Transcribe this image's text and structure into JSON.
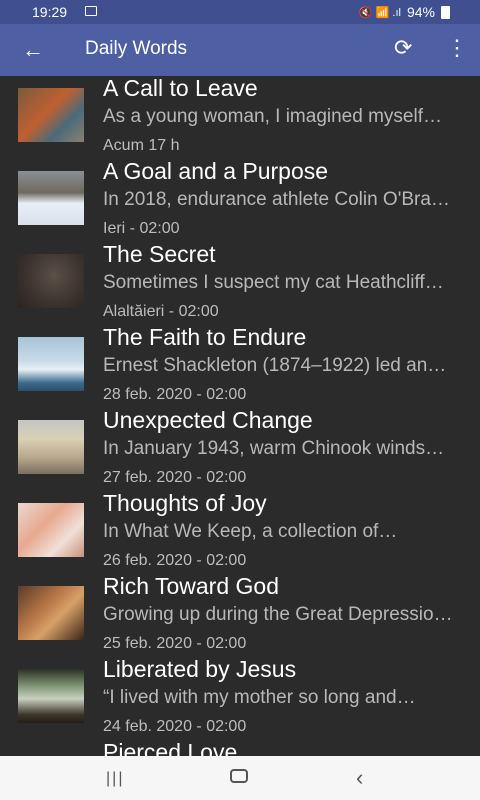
{
  "status": {
    "time": "19:29",
    "battery": "94%",
    "signal_icons": "🔇 📶 .ıl"
  },
  "appbar": {
    "title": "Daily Words",
    "back_icon": "←",
    "refresh_icon": "⟳",
    "more_icon": "⋮"
  },
  "items": [
    {
      "title": "A Call to Leave",
      "snippet": "As a young woman, I imagined myself…",
      "date": "Acum 17 h",
      "thumb": "linear-gradient(135deg,#7a5a3e,#c06030 45%,#4a6a7a 70%,#8a8070)"
    },
    {
      "title": "A Goal and a Purpose",
      "snippet": "In 2018, endurance athlete Colin O'Brady…",
      "date": "Ieri - 02:00",
      "thumb": "linear-gradient(180deg,#8a8f95 0%,#6f6a60 40%,#e8eef5 60%,#d8e2ec 100%)"
    },
    {
      "title": "The Secret",
      "snippet": "Sometimes I suspect my cat Heathcliff…",
      "date": "Alaltăieri - 02:00",
      "thumb": "radial-gradient(circle at 55% 40%,#5c5048,#3a322c 60%,#2a2420)"
    },
    {
      "title": "The Faith to Endure",
      "snippet": "Ernest Shackleton (1874–1922) led an…",
      "date": "28 feb. 2020 - 02:00",
      "thumb": "linear-gradient(180deg,#a8c3d8 0%,#c9dbe8 45%,#e8f0f6 60%,#3c6a8c 85%,#2c4f6c 100%)"
    },
    {
      "title": "Unexpected Change",
      "snippet": "In January 1943, warm Chinook winds…",
      "date": "27 feb. 2020 - 02:00",
      "thumb": "linear-gradient(180deg,#c2c6c4 0%,#d9d0b5 35%,#b7a68a 70%,#7a7060 100%)"
    },
    {
      "title": "Thoughts of Joy",
      "snippet": "In What We Keep, a collection of…",
      "date": "26 feb. 2020 - 02:00",
      "thumb": "linear-gradient(135deg,#e8d8d0,#e8a890 40%,#f0e0d8 70%,#c89078)"
    },
    {
      "title": "Rich Toward God",
      "snippet": "Growing up during the Great Depression…",
      "date": "25 feb. 2020 - 02:00",
      "thumb": "linear-gradient(135deg,#5a3a28,#b87848 40%,#d8a068 60%,#3a2418)"
    },
    {
      "title": "Liberated by Jesus",
      "snippet": "“I lived with my mother so long and…",
      "date": "24 feb. 2020 - 02:00",
      "thumb": "linear-gradient(180deg,#2c3024 0%,#8aa080 35%,#c8d0c0 55%,#3a3428 85%,#241e18 100%)"
    },
    {
      "title": "Pierced Love",
      "snippet": "",
      "date": "",
      "thumb": "linear-gradient(135deg,#444,#666)"
    }
  ],
  "navbar": {
    "recents_icon": "|||",
    "back_icon": "‹"
  }
}
